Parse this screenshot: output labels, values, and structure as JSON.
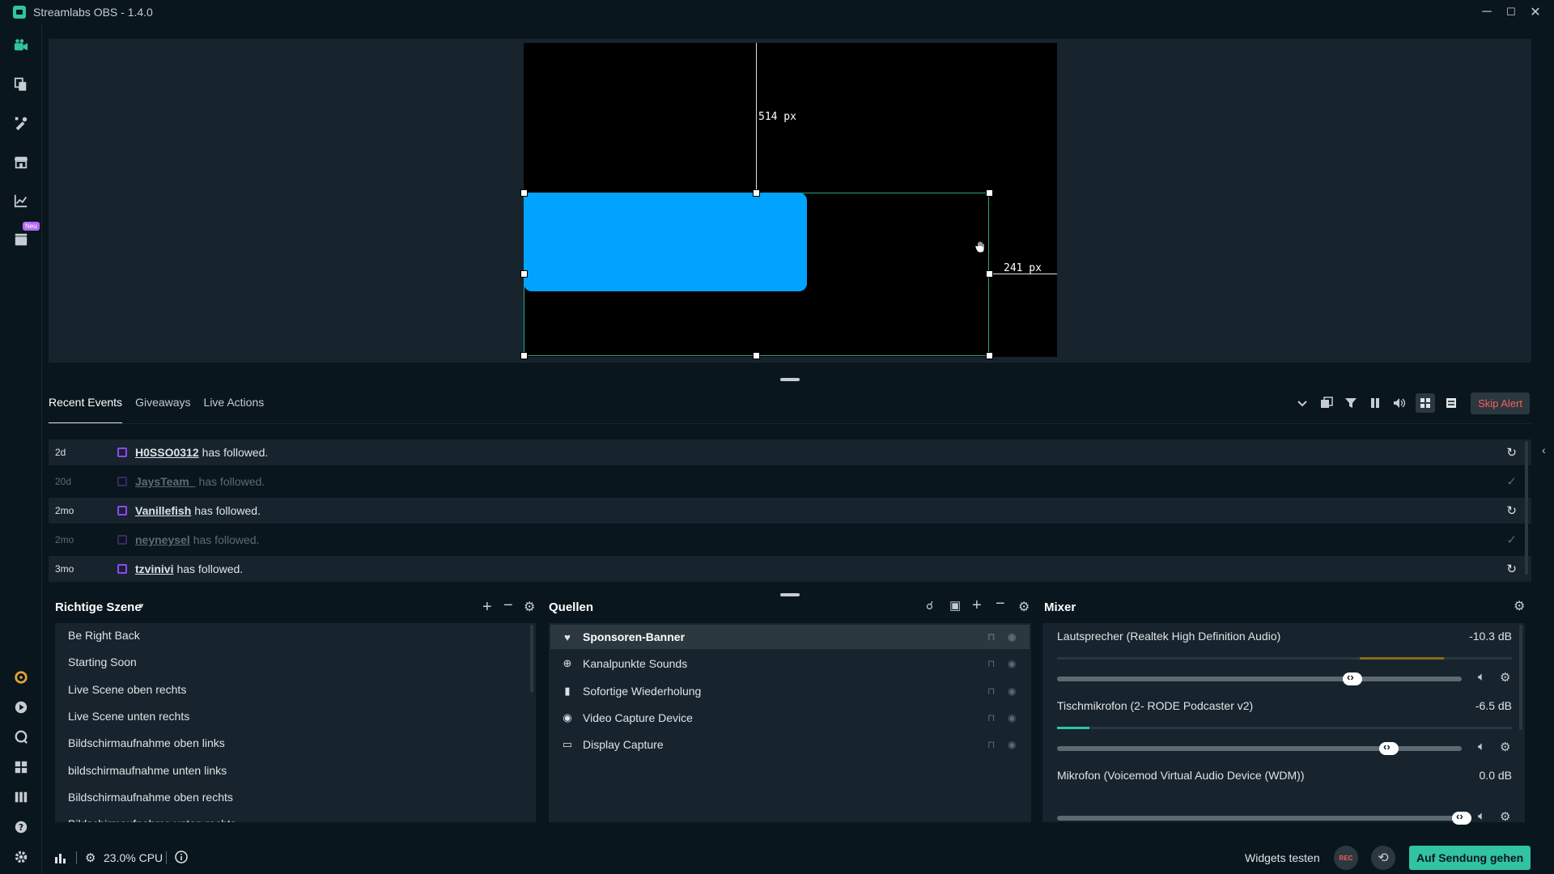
{
  "window": {
    "title": "Streamlabs OBS - 1.4.0",
    "minimize": "─",
    "maximize": "☐",
    "close": "✕"
  },
  "nav": {
    "top_icons": [
      "studio-icon",
      "themes-icon",
      "editor-icon",
      "store-icon",
      "dashboard-icon",
      "highlighter-icon"
    ],
    "new_badge": "Neu",
    "bottom_icons": [
      "settings-gear-icon",
      "play-icon",
      "chat-icon",
      "layout-icon",
      "studio-mode-icon",
      "help-icon",
      "settings-icon"
    ]
  },
  "preview": {
    "vertical_distance": "514 px",
    "horizontal_distance": "241 px"
  },
  "events": {
    "tabs": [
      "Recent Events",
      "Giveaways",
      "Live Actions"
    ],
    "skip_alert": "Skip Alert",
    "rows": [
      {
        "age": "2d",
        "user": "H0SSO0312",
        "action": "has followed.",
        "icon": "↻",
        "dim": false
      },
      {
        "age": "20d",
        "user": "JaysTeam_",
        "action": "has followed.",
        "icon": "✓",
        "dim": true
      },
      {
        "age": "2mo",
        "user": "Vanillefish",
        "action": "has followed.",
        "icon": "↻",
        "dim": false
      },
      {
        "age": "2mo",
        "user": "neyneysel",
        "action": "has followed.",
        "icon": "✓",
        "dim": true
      },
      {
        "age": "3mo",
        "user": "tzvinivi",
        "action": "has followed.",
        "icon": "↻",
        "dim": false
      }
    ]
  },
  "scenes": {
    "title": "Richtige Szene",
    "items": [
      "Be Right Back",
      "Starting Soon",
      "Live Scene oben rechts",
      "Live Scene unten rechts",
      "Bildschirmaufnahme oben links",
      "bildschirmaufnahme unten links",
      "Bildschirmaufnahme oben rechts"
    ]
  },
  "sources": {
    "title": "Quellen",
    "items": [
      {
        "name": "Sponsoren-Banner",
        "icon": "♥",
        "selected": true
      },
      {
        "name": "Kanalpunkte Sounds",
        "icon": "⊕",
        "selected": false
      },
      {
        "name": "Sofortige Wiederholung",
        "icon": "▮",
        "selected": false
      },
      {
        "name": "Video Capture Device",
        "icon": "◉",
        "selected": false
      },
      {
        "name": "Display Capture",
        "icon": "▭",
        "selected": false
      }
    ]
  },
  "mixer": {
    "title": "Mixer",
    "channels": [
      {
        "name": "Lautsprecher (Realtek High Definition Audio)",
        "db": "-10.3 dB",
        "level": 0.73
      },
      {
        "name": "Tischmikrofon (2- RODE Podcaster v2)",
        "db": "-6.5 dB",
        "level": 0.82
      },
      {
        "name": "Mikrofon (Voicemod Virtual Audio Device (WDM))",
        "db": "0.0 dB",
        "level": 1.0
      }
    ]
  },
  "footer": {
    "cpu": "23.0% CPU",
    "widgets_test": "Widgets testen",
    "rec": "REC",
    "go_live": "Auf Sendung gehen"
  },
  "colors": {
    "background": "#09161d",
    "panel": "#17242d",
    "accent": "#31c3a2",
    "source_blue": "#00a3ff",
    "skip_red": "#f85e5e",
    "twitch_purple": "#9146ff"
  }
}
